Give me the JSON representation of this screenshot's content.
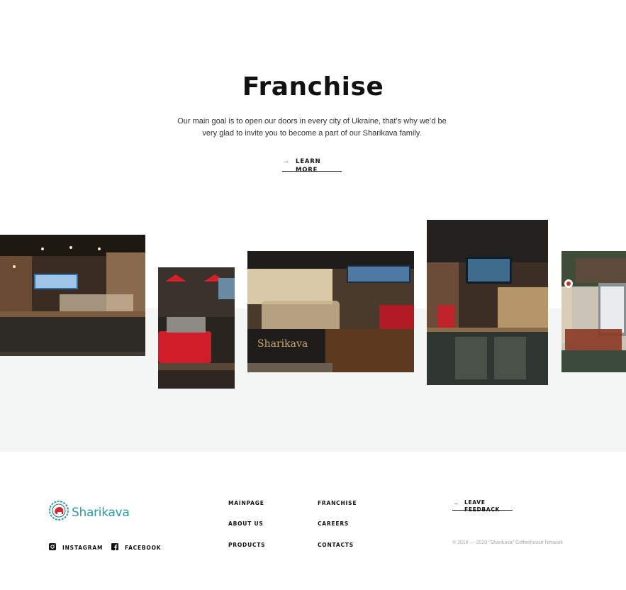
{
  "hero": {
    "title": "Franchise",
    "text": "Our main goal is to open our doors in every city of Ukraine, that’s why we’d be very glad to invite you to become a part of our Sharikava family.",
    "cta_label": "LEARN MORE"
  },
  "gallery": {
    "photos": [
      "coffee-shop-counter-interior",
      "red-espresso-machine-with-red-lamps",
      "pastry-display-counter-with-logo",
      "coffee-bar-with-menu-boards",
      "street-terrace-exterior"
    ],
    "counter_sign": "Sharikava"
  },
  "footer": {
    "logo_text": "Sharikava",
    "social": {
      "instagram": "INSTAGRAM",
      "facebook": "FACEBOOK"
    },
    "nav": {
      "col1": [
        "MAINPAGE",
        "ABOUT US",
        "PRODUCTS"
      ],
      "col2": [
        "FRANCHISE",
        "CAREERS",
        "CONTACTS"
      ]
    },
    "feedback_label": "LEAVE FEEDBACK",
    "copyright": "© 2016 — 2020 \"Sharikava\" Coffeehouse Network"
  },
  "colors": {
    "accent": "#d7262b",
    "brand": "#2a9aa7",
    "gallery_bg": "#f4f6f5"
  }
}
